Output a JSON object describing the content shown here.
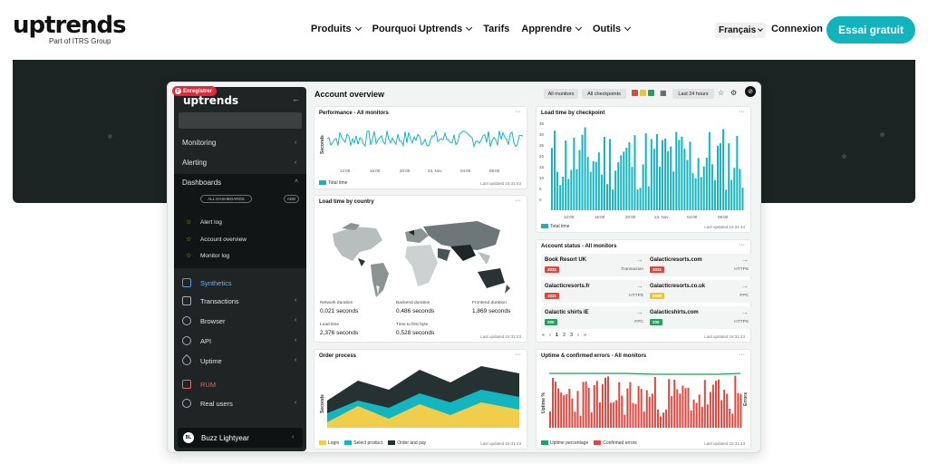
{
  "nav": {
    "logo": "uptrends",
    "logo_sub": "Part of ITRS Group",
    "menu": [
      {
        "label": "Produits",
        "has_dropdown": true
      },
      {
        "label": "Pourquoi Uptrends",
        "has_dropdown": true
      },
      {
        "label": "Tarifs",
        "has_dropdown": false
      },
      {
        "label": "Apprendre",
        "has_dropdown": true
      },
      {
        "label": "Outils",
        "has_dropdown": true
      }
    ],
    "language": "Français",
    "login": "Connexion",
    "trial": "Essai gratuit",
    "accent_color": "#11b3bd"
  },
  "pinterest_badge": "Enregistrer",
  "sidebar": {
    "logo": "uptrends",
    "items": {
      "monitoring": "Monitoring",
      "alerting": "Alerting",
      "dashboards": "Dashboards"
    },
    "dash_all": "ALL DASHBOARDS",
    "dash_add": "ADD",
    "dashboards": [
      "Alert log",
      "Account overview",
      "Monitor log"
    ],
    "sections": {
      "synthetics": "Synthetics",
      "transactions": "Transactions",
      "browser": "Browser",
      "api": "API",
      "uptime": "Uptime",
      "rum": "RUM",
      "real_users": "Real users"
    },
    "user_initials": "BL",
    "user_name": "Buzz Lightyear"
  },
  "main": {
    "title": "Account overview",
    "toolbar": {
      "all_monitors": "All monitors",
      "all_checkpoints": "All checkpoints",
      "range": "Last 24 hours",
      "status_colors": [
        "#e0463e",
        "#e9c53a",
        "#1fa15a"
      ]
    }
  },
  "panels": {
    "performance": {
      "title": "Performance - All monitors",
      "ylabel": "Seconds",
      "ticks": [
        "12:00",
        "16:00",
        "20:00",
        "23. Nov",
        "04:00",
        "08:00"
      ],
      "legend": "Total time",
      "updated": "Last updated 16:31:43"
    },
    "checkpoint": {
      "title": "Load time by checkpoint",
      "yticks": [
        "35",
        "30",
        "25",
        "20",
        "15",
        "10",
        "5",
        "0"
      ],
      "ticks": [
        "12:00",
        "16:00",
        "20:00",
        "23. Nov",
        "04:00",
        "08:00"
      ],
      "legend": "Total time",
      "updated": "Last updated 16:31:43"
    },
    "country": {
      "title": "Load time by country",
      "stats": [
        {
          "label": "Network duration",
          "value": "0,021 seconds"
        },
        {
          "label": "Backend duration",
          "value": "0,486 seconds"
        },
        {
          "label": "Frontend duration",
          "value": "1,869 seconds"
        },
        {
          "label": "Load time",
          "value": "2,376 seconds"
        },
        {
          "label": "Time to first byte",
          "value": "0,528 seconds"
        }
      ],
      "updated": "Last updated 16:31:43"
    },
    "account": {
      "title": "Account status - All monitors",
      "cards": [
        {
          "name": "Book Resort UK",
          "code": "3031",
          "type": "Transaction",
          "color": "#e0463e"
        },
        {
          "name": "Galacticresorts.com",
          "code": "3031",
          "type": "HTTPS",
          "color": "#e0463e"
        },
        {
          "name": "Galacticresorts.fr",
          "code": "3031",
          "type": "HTTPS",
          "color": "#e0463e"
        },
        {
          "name": "Galacticresorts.co.uk",
          "code": "2008",
          "type": "FPC",
          "color": "#e9c53a"
        },
        {
          "name": "Galactic shirts IE",
          "code": "200",
          "type": "FPC",
          "color": "#1fa15a"
        },
        {
          "name": "Galacticshirts.com",
          "code": "200",
          "type": "HTTPS",
          "color": "#1fa15a"
        }
      ],
      "pager": [
        "«",
        "‹",
        "1",
        "2",
        "3",
        "›",
        "»"
      ],
      "updated": "Last updated 16:31:43"
    },
    "order": {
      "title": "Order process",
      "ylabel": "Seconds",
      "legend": [
        "Login",
        "Select product",
        "Order and pay"
      ],
      "colors": [
        "#f0cd4a",
        "#13b5c0",
        "#263232"
      ],
      "updated": "Last updated 16:31:43"
    },
    "uptime": {
      "title": "Uptime & confirmed errors - All monitors",
      "ylabel_left": "Uptime %",
      "ylabel_right": "Errors",
      "legend": [
        "Uptime percentage",
        "Confirmed errors"
      ],
      "colors": [
        "#1fa15a",
        "#e0463e"
      ],
      "updated": "Last updated 16:31:43"
    }
  }
}
